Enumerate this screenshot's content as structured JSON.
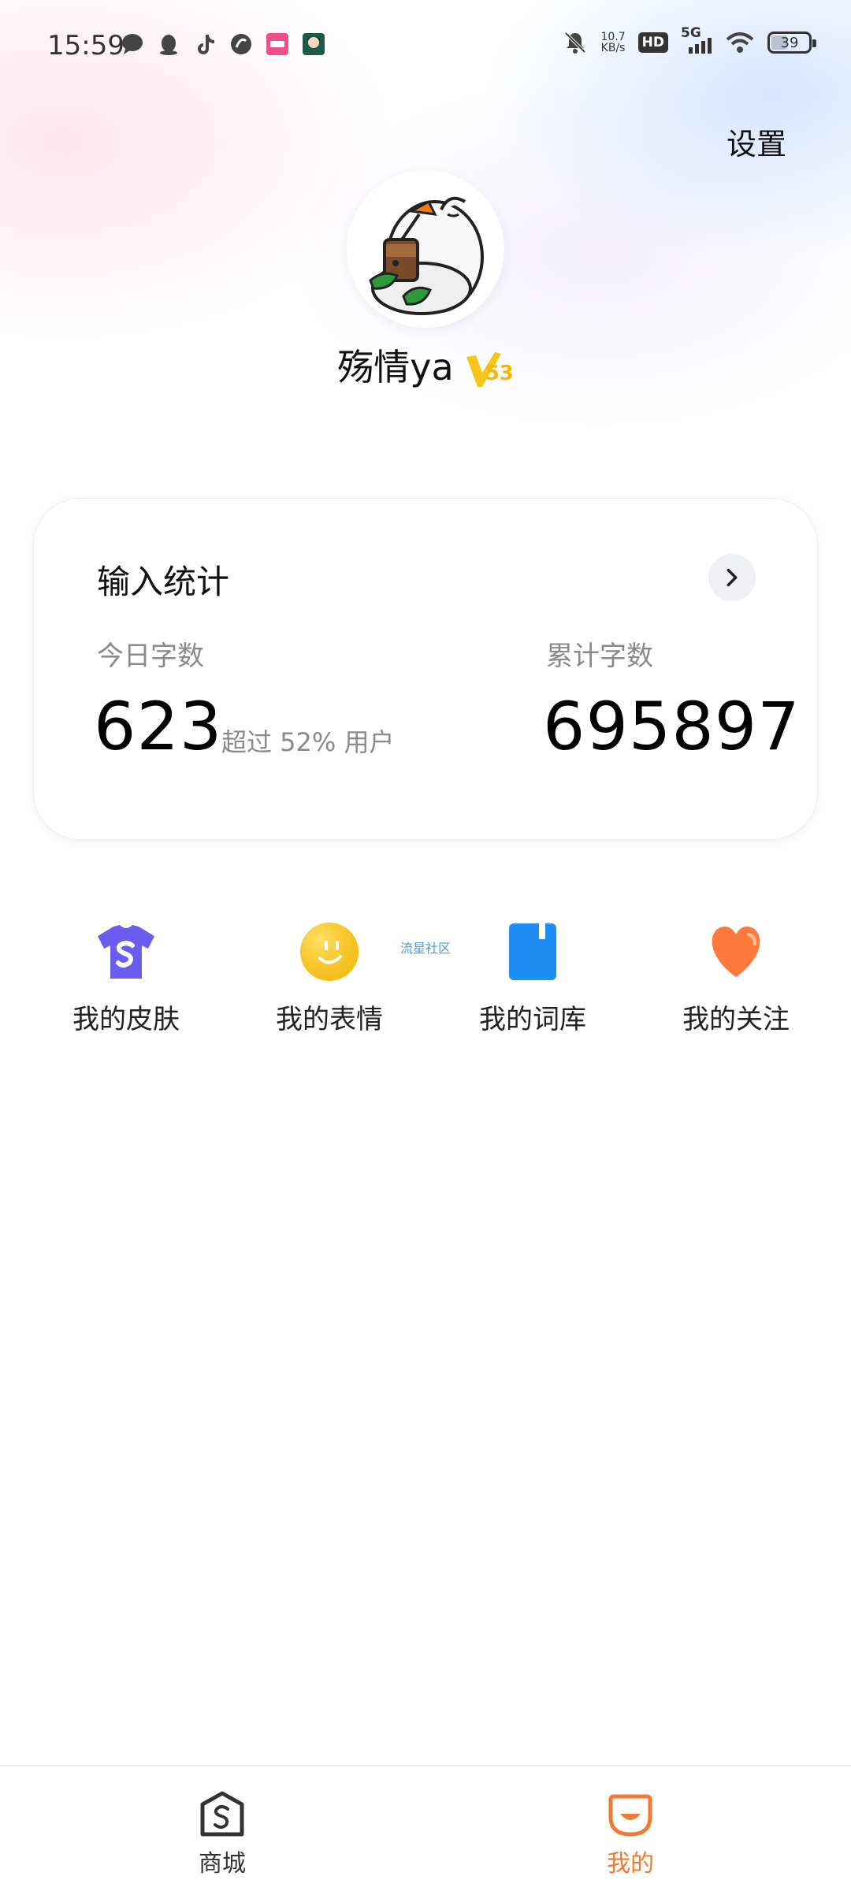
{
  "status_bar": {
    "time": "15:59",
    "net_speed_value": "10.7",
    "net_speed_unit": "KB/s",
    "hd_label": "HD",
    "network": "5G",
    "battery": "39",
    "battery_level_percent": 39,
    "left_icons": [
      "message-icon",
      "qq-icon",
      "tiktok-icon",
      "browser-icon",
      "app-icon",
      "avatar-app-icon"
    ],
    "right_icons": [
      "mute-bell-icon",
      "signal-icon",
      "wifi-icon"
    ]
  },
  "header": {
    "settings_label": "设置"
  },
  "profile": {
    "username": "殇情ya",
    "vip_level": "53",
    "vip_letter": "V"
  },
  "input_stats": {
    "title": "输入统计",
    "today_label": "今日字数",
    "today_value": "623",
    "today_note": "超过 52% 用户",
    "total_label": "累计字数",
    "total_value": "695897"
  },
  "actions": {
    "community_tag": "流星社区",
    "items": [
      {
        "label": "我的皮肤",
        "icon": "shirt-icon",
        "color": "#6b5cf0"
      },
      {
        "label": "我的表情",
        "icon": "smiley-icon",
        "color": "#f6c21b"
      },
      {
        "label": "我的词库",
        "icon": "book-icon",
        "color": "#1e8ef5"
      },
      {
        "label": "我的关注",
        "icon": "heart-icon",
        "color": "#ff7a3c"
      }
    ]
  },
  "bottom_nav": {
    "items": [
      {
        "label": "商城",
        "icon": "store-icon",
        "active": false,
        "color": "#333333"
      },
      {
        "label": "我的",
        "icon": "mine-icon",
        "active": true,
        "color": "#f07a32"
      }
    ]
  }
}
